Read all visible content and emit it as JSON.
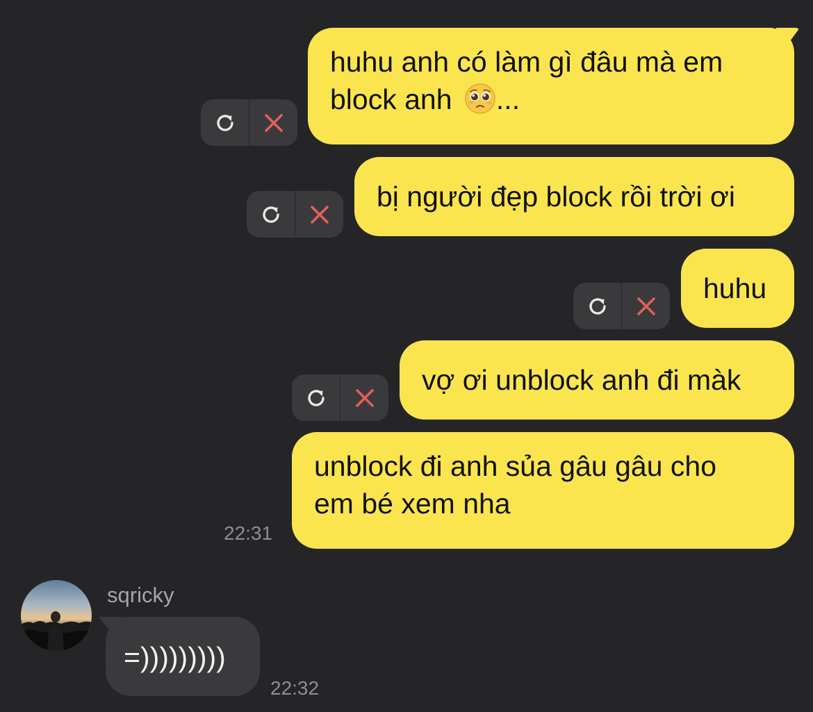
{
  "colors": {
    "background": "#252527",
    "outgoing_bubble": "#fae54f",
    "incoming_bubble": "#3a3a3c",
    "retry_icon": "#e8e8e8",
    "delete_icon": "#e2605a",
    "timestamp": "#8e8e93"
  },
  "messages": [
    {
      "lines": [
        "huhu anh có làm gì đâu mà em",
        "block anh "
      ],
      "emoji": "pleading-face-icon",
      "suffix": "...",
      "status": "failed"
    },
    {
      "lines": [
        "bị người đẹp block rồi trời ơi"
      ],
      "status": "failed"
    },
    {
      "lines": [
        "huhu"
      ],
      "status": "failed"
    },
    {
      "lines": [
        "vợ ơi unblock anh đi màk"
      ],
      "status": "failed"
    },
    {
      "lines": [
        "unblock đi anh sủa gâu gâu cho",
        "em bé xem nha"
      ],
      "time": "22:31"
    }
  ],
  "incoming": {
    "sender": "sqricky",
    "text": "=)))))))))",
    "time": "22:32"
  },
  "actions": {
    "retry_icon": "retry-icon",
    "delete_icon": "delete-icon"
  }
}
